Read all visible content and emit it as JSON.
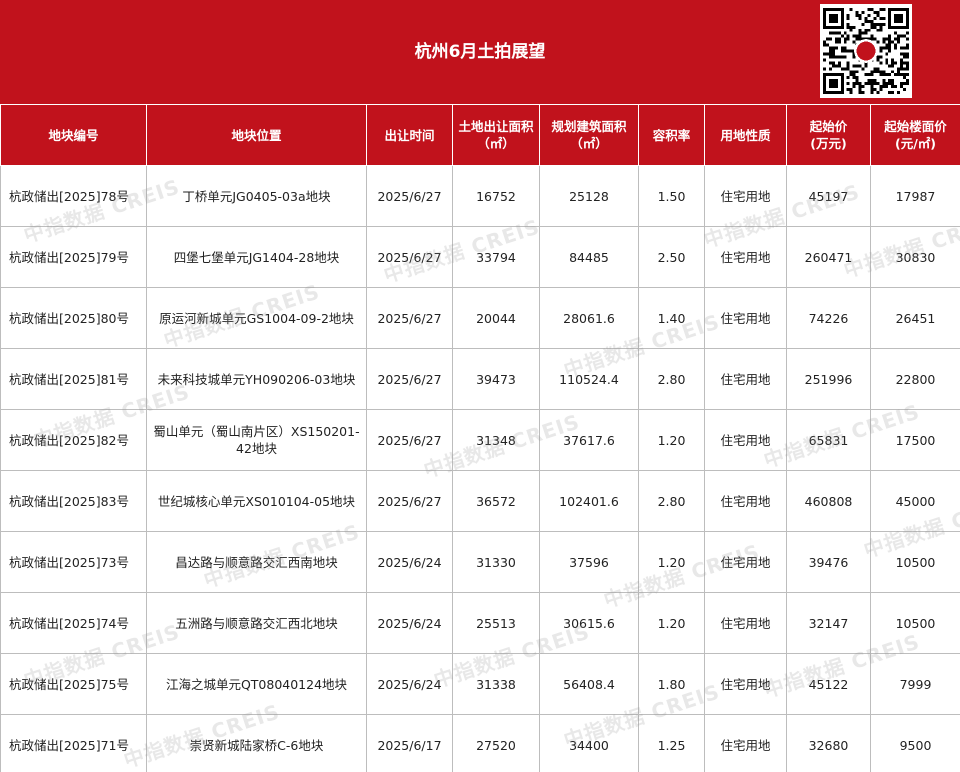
{
  "title": "杭州6月土拍展望",
  "headers": [
    [
      "地块编号"
    ],
    [
      "地块位置"
    ],
    [
      "出让时间"
    ],
    [
      "土地出让面积",
      "（㎡）"
    ],
    [
      "规划建筑面积",
      "（㎡）"
    ],
    [
      "容积率"
    ],
    [
      "用地性质"
    ],
    [
      "起始价",
      "(万元)"
    ],
    [
      "起始楼面价",
      "(元/㎡)"
    ]
  ],
  "rows": [
    [
      "杭政储出[2025]78号",
      "丁桥单元JG0405-03a地块",
      "2025/6/27",
      "16752",
      "25128",
      "1.50",
      "住宅用地",
      "45197",
      "17987"
    ],
    [
      "杭政储出[2025]79号",
      "四堡七堡单元JG1404-28地块",
      "2025/6/27",
      "33794",
      "84485",
      "2.50",
      "住宅用地",
      "260471",
      "30830"
    ],
    [
      "杭政储出[2025]80号",
      "原运河新城单元GS1004-09-2地块",
      "2025/6/27",
      "20044",
      "28061.6",
      "1.40",
      "住宅用地",
      "74226",
      "26451"
    ],
    [
      "杭政储出[2025]81号",
      "未来科技城单元YH090206-03地块",
      "2025/6/27",
      "39473",
      "110524.4",
      "2.80",
      "住宅用地",
      "251996",
      "22800"
    ],
    [
      "杭政储出[2025]82号",
      "蜀山单元（蜀山南片区）XS150201-42地块",
      "2025/6/27",
      "31348",
      "37617.6",
      "1.20",
      "住宅用地",
      "65831",
      "17500"
    ],
    [
      "杭政储出[2025]83号",
      "世纪城核心单元XS010104-05地块",
      "2025/6/27",
      "36572",
      "102401.6",
      "2.80",
      "住宅用地",
      "460808",
      "45000"
    ],
    [
      "杭政储出[2025]73号",
      "昌达路与顺意路交汇西南地块",
      "2025/6/24",
      "31330",
      "37596",
      "1.20",
      "住宅用地",
      "39476",
      "10500"
    ],
    [
      "杭政储出[2025]74号",
      "五洲路与顺意路交汇西北地块",
      "2025/6/24",
      "25513",
      "30615.6",
      "1.20",
      "住宅用地",
      "32147",
      "10500"
    ],
    [
      "杭政储出[2025]75号",
      "江海之城单元QT08040124地块",
      "2025/6/24",
      "31338",
      "56408.4",
      "1.80",
      "住宅用地",
      "45122",
      "7999"
    ],
    [
      "杭政储出[2025]71号",
      "崇贤新城陆家桥C-6地块",
      "2025/6/17",
      "27520",
      "34400",
      "1.25",
      "住宅用地",
      "32680",
      "9500"
    ]
  ],
  "watermark": "中指数据 CREIS",
  "colors": {
    "header_bg": "#c1121c",
    "header_text": "#ffffff",
    "grid": "#bdbdbd"
  },
  "icons": {
    "qr": "qr-code-icon"
  }
}
